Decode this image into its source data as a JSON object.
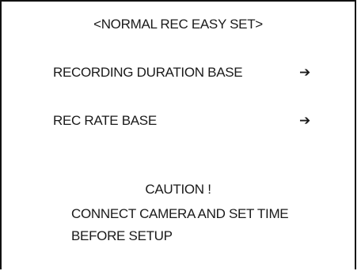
{
  "screen": {
    "title": "<NORMAL REC EASY SET>",
    "menu": [
      {
        "label": "RECORDING DURATION BASE",
        "icon": "arrow-right-icon",
        "arrow": "➔"
      },
      {
        "label": "REC RATE BASE",
        "icon": "arrow-right-icon",
        "arrow": "➔"
      }
    ],
    "caution": {
      "title": "CAUTION !",
      "lines": [
        "CONNECT CAMERA AND SET TIME",
        "BEFORE SETUP"
      ]
    }
  }
}
